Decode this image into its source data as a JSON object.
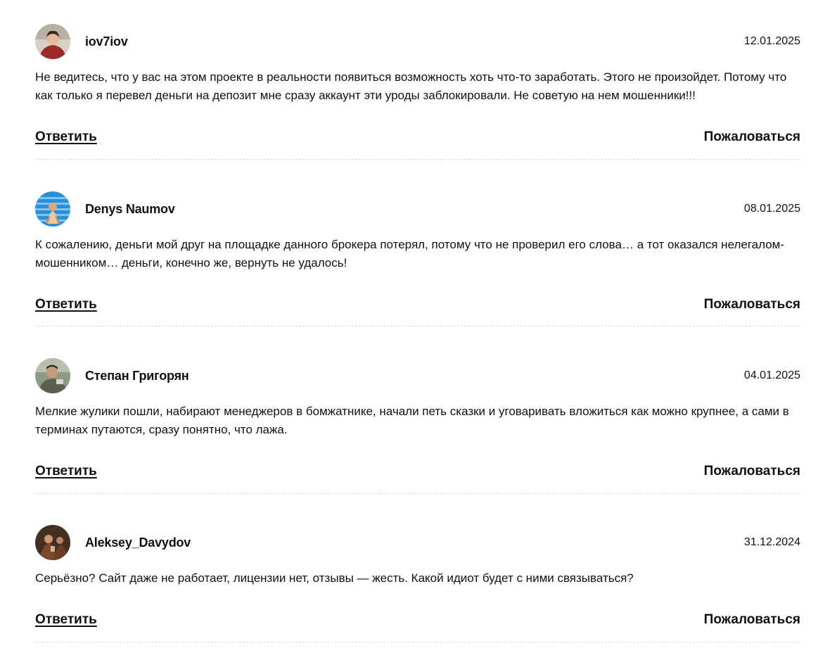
{
  "comments": [
    {
      "author": "iov7iov",
      "date": "12.01.2025",
      "text": "Не ведитесь, что у вас на этом проекте в реальности появиться возможность хоть что-то заработать. Этого не произойдет. Потому что как только я перевел деньги на депозит мне сразу аккаунт эти уроды заблокировали. Не советую на нем мошенники!!!",
      "reply_label": "Ответить",
      "report_label": "Пожаловаться"
    },
    {
      "author": "Denys Naumov",
      "date": "08.01.2025",
      "text": "К сожалению, деньги мой друг на площадке данного брокера потерял, потому что не проверил его слова… а тот оказался нелегалом-мошенником… деньги, конечно же, вернуть не удалось!",
      "reply_label": "Ответить",
      "report_label": "Пожаловаться"
    },
    {
      "author": "Степан Григорян",
      "date": "04.01.2025",
      "text": "Мелкие жулики пошли, набирают менеджеров в бомжатнике, начали петь сказки и уговаривать вложиться как можно крупнее, а сами в терминах путаются, сразу понятно, что лажа.",
      "reply_label": "Ответить",
      "report_label": "Пожаловаться"
    },
    {
      "author": "Aleksey_Davydov",
      "date": "31.12.2024",
      "text": "Серьёзно? Сайт даже не работает, лицензии нет, отзывы — жесть. Какой идиот будет с ними связываться?",
      "reply_label": "Ответить",
      "report_label": "Пожаловаться"
    }
  ]
}
